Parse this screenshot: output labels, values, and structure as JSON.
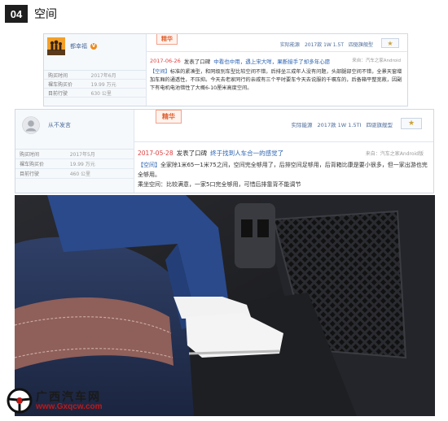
{
  "section": {
    "number": "04",
    "title": "空间"
  },
  "review1": {
    "username": "都幸福",
    "badge": "精华",
    "info": [
      {
        "key": "购买时间",
        "value": "2017年6月"
      },
      {
        "key": "裸车购买价",
        "value": "19.99 万元"
      },
      {
        "key": "目前行驶",
        "value": "630 公里"
      }
    ],
    "tags": [
      "实际能源",
      "2017款 1W 1.5T",
      "四驱旗舰型"
    ],
    "date": "2017-06-26",
    "action": "发表了口碑",
    "title": "中看也中用，遇上宋大咩，果断接手了却多年心愿",
    "source": "来自：汽车之家Android",
    "body_label": "【空间】",
    "body": "标准的紧凑型，和同级别车型比较空间不错，后排坐三成年人没有问题，头部腿部空间不错，全景天窗增加车厢的通透性，不压抑。今天去老家同行的亲戚有三个平时要车今天去说服的千嘱车的，后备箱平整宽敞，因副下有电机电池错性了大概6-10厘米高度空间。"
  },
  "review2": {
    "username": "从不发言",
    "badge": "精华",
    "info": [
      {
        "key": "购买时间",
        "value": "2017年5月"
      },
      {
        "key": "裸车购买价",
        "value": "19.99 万元"
      },
      {
        "key": "目前行驶",
        "value": "460 公里"
      }
    ],
    "tags": [
      "实际能源",
      "2017款 1W 1.5TI",
      "四驱旗舰型"
    ],
    "date": "2017-05-28",
    "action": "发表了口碑",
    "title": "终于找到人车合一的感觉了",
    "source": "来自：汽车之家Android版",
    "body_label": "【空间】",
    "body_lines": [
      "全家除1米65一1米75之间，空间完全够用了，后排空间足够用，后背箱比康是要小很多，但一家出游也完全够用。",
      "乘坐空间：比较满意，一家5口完全够用，可惜后排靠背不能调节"
    ]
  },
  "watermark": {
    "name": "广西汽车网",
    "url": "www.Gxqcw.com"
  },
  "colors": {
    "accent_blue": "#2a62b0",
    "date_red": "#e04040",
    "badge_orange": "#e0602e",
    "header_dark": "#1e1e1e"
  }
}
